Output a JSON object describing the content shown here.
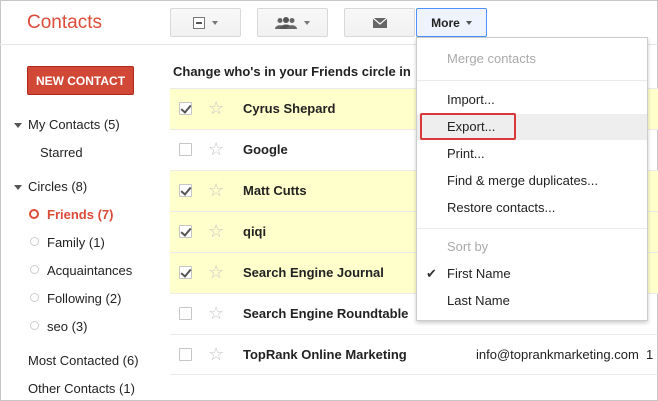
{
  "app": {
    "title": "Contacts"
  },
  "toolbar": {
    "select_icon": "checkbox-select-icon",
    "groups_icon": "people-icon",
    "email_icon": "envelope-icon",
    "more_label": "More"
  },
  "sidebar": {
    "new_contact": "NEW CONTACT",
    "my_contacts": "My Contacts (5)",
    "starred": "Starred",
    "circles": "Circles (8)",
    "circle_items": [
      "Friends (7)",
      "Family (1)",
      "Acquaintances",
      "Following (2)",
      "seo (3)"
    ],
    "most_contacted": "Most Contacted (6)",
    "other_contacts": "Other Contacts (1)"
  },
  "list": {
    "header": "Change who's in your Friends circle in",
    "rows": [
      {
        "name": "Cyrus Shepard",
        "checked": true,
        "email": "",
        "extra": ""
      },
      {
        "name": "Google",
        "checked": false,
        "email": "",
        "extra": ""
      },
      {
        "name": "Matt Cutts",
        "checked": true,
        "email": "",
        "extra": ""
      },
      {
        "name": "qiqi",
        "checked": true,
        "email": "",
        "extra": ""
      },
      {
        "name": "Search Engine Journal",
        "checked": true,
        "email": "",
        "extra": ""
      },
      {
        "name": "Search Engine Roundtable",
        "checked": false,
        "email": "",
        "extra": ""
      },
      {
        "name": "TopRank Online Marketing",
        "checked": false,
        "email": "info@toprankmarketing.com",
        "extra": "1"
      }
    ]
  },
  "more_menu": {
    "merge_contacts": "Merge contacts",
    "import": "Import...",
    "export": "Export...",
    "print": "Print...",
    "find_merge": "Find & merge duplicates...",
    "restore": "Restore contacts...",
    "sort_by": "Sort by",
    "first_name": "First Name",
    "last_name": "Last Name",
    "check_mark": "✔"
  },
  "colors": {
    "accent_red": "#dd4b39",
    "selected_row": "#ffffcc",
    "highlight_box": "#d9383a"
  }
}
